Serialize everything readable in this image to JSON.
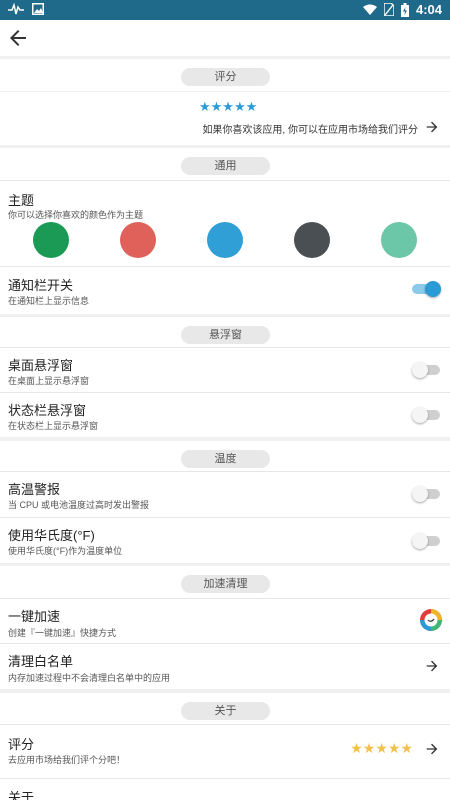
{
  "status_bar": {
    "time": "4:04",
    "icons": [
      "pulse-icon",
      "image-icon",
      "wifi-icon",
      "no-sim-icon",
      "battery-charging-icon"
    ]
  },
  "header": {
    "back_icon": "arrow-left-icon"
  },
  "sections": {
    "rating": {
      "label": "评分",
      "stars": "★★★★★",
      "description": "如果你喜欢该应用, 你可以在应用市场给我们评分"
    },
    "general": {
      "label": "通用",
      "theme": {
        "title": "主题",
        "subtitle": "你可以选择你喜欢的颜色作为主题",
        "colors": [
          "#1a9a55",
          "#e0605a",
          "#2f9fd5",
          "#4a4f54",
          "#6bc7a8"
        ]
      },
      "notification": {
        "title": "通知栏开关",
        "subtitle": "在通知栏上显示信息",
        "on": true
      }
    },
    "floating": {
      "label": "悬浮窗",
      "desktop": {
        "title": "桌面悬浮窗",
        "subtitle": "在桌面上显示悬浮窗",
        "on": false
      },
      "statusbar": {
        "title": "状态栏悬浮窗",
        "subtitle": "在状态栏上显示悬浮窗",
        "on": false
      }
    },
    "temperature": {
      "label": "温度",
      "alarm": {
        "title": "高温警报",
        "subtitle": "当 CPU 或电池温度过高时发出警报",
        "on": false
      },
      "fahrenheit": {
        "title": "使用华氏度(°F)",
        "subtitle": "使用华氏度(°F)作为温度单位",
        "on": false
      }
    },
    "boost": {
      "label": "加速清理",
      "one_key": {
        "title": "一键加速",
        "subtitle": "创建『一键加速』快捷方式"
      },
      "whitelist": {
        "title": "清理白名单",
        "subtitle": "内存加速过程中不会清理白名单中的应用"
      }
    },
    "about": {
      "label": "关于",
      "rate": {
        "title": "评分",
        "subtitle": "去应用市场给我们评个分吧！",
        "stars": "★★★★★"
      },
      "about_item": {
        "title": "关于"
      }
    }
  },
  "colors": {
    "accent": "#2b9bd6",
    "status_bar": "#1f6a8a",
    "star_gold": "#f2c14d"
  }
}
